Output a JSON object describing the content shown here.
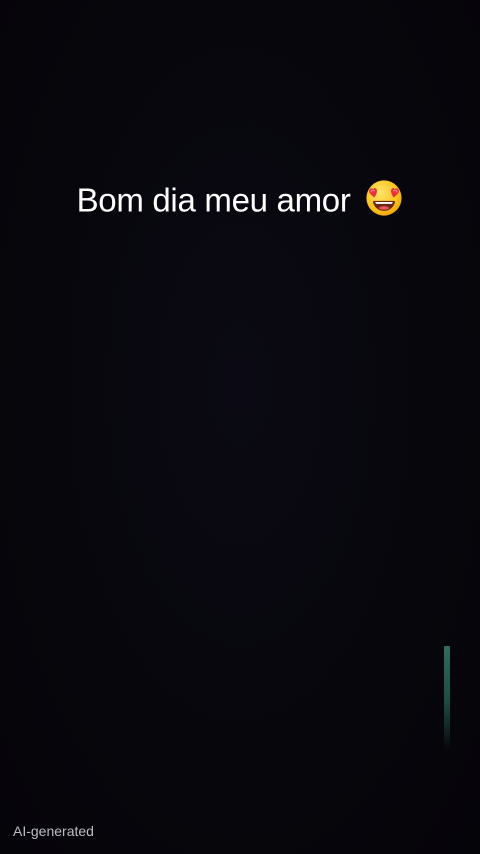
{
  "caption": {
    "text": "Bom dia meu amor",
    "emoji_icon": "heart-eyes-emoji-icon"
  },
  "badge": {
    "label": "AI-generated"
  },
  "colors": {
    "background": "#07060d",
    "caption_text": "#ffffff",
    "badge_text": "#bdbdc4",
    "indicator": "#2f6d5e"
  }
}
